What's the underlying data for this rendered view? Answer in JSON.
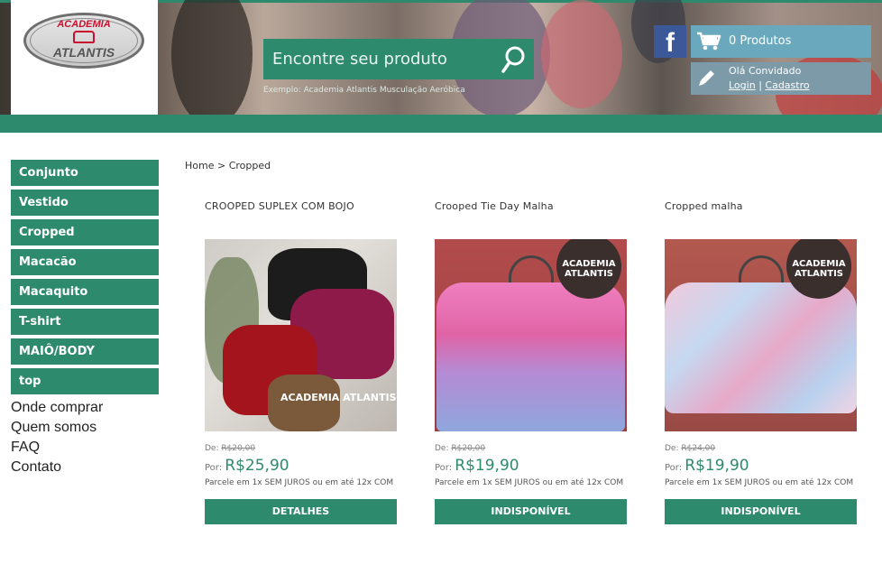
{
  "header": {
    "logo_top": "ACADEMIA",
    "logo_bottom": "ATLANTIS",
    "search": {
      "placeholder": "Encontre seu produto",
      "hint": "Exemplo: Academia Atlantis Musculação Aeróbica"
    },
    "facebook_glyph": "f",
    "cart_label": "0 Produtos",
    "user": {
      "hello": "Olá Convidado",
      "login": "Login",
      "separator": "|",
      "register": "Cadastro"
    }
  },
  "sidebar": {
    "categories": [
      "Conjunto",
      "Vestido",
      "Cropped",
      "Macacão",
      "Macaquito",
      "T-shirt",
      "MAIÔ/BODY",
      "top"
    ],
    "links": [
      "Onde comprar",
      "Quem somos",
      "FAQ",
      "Contato"
    ]
  },
  "breadcrumb": {
    "home": "Home",
    "separator": ">",
    "current": "Cropped"
  },
  "products": [
    {
      "title": "CROOPED SUPLEX COM BOJO",
      "old_label": "De:",
      "old_price": "R$20,00",
      "now_label": "Por:",
      "price": "R$25,90",
      "parcel": "Parcele em 1x SEM JUROS ou em até 12x COM",
      "button": "DETALHES",
      "image_text": "ACADEMIA ATLANTIS"
    },
    {
      "title": "Crooped Tie Day Malha",
      "old_label": "De:",
      "old_price": "R$20,00",
      "now_label": "Por:",
      "price": "R$19,90",
      "parcel": "Parcele em 1x SEM JUROS ou em até 12x COM",
      "button": "INDISPONÍVEL",
      "image_text": "ACADEMIA ATLANTIS"
    },
    {
      "title": "Cropped malha",
      "old_label": "De:",
      "old_price": "R$24,00",
      "now_label": "Por:",
      "price": "R$19,90",
      "parcel": "Parcele em 1x SEM JUROS ou em até 12x COM",
      "button": "INDISPONÍVEL",
      "image_text": "ACADEMIA ATLANTIS"
    }
  ],
  "colors": {
    "brand_green": "#2e8a6c",
    "facebook_blue": "#3b5998",
    "cart_blue": "#6aa9bd",
    "user_gray": "#7c9aa8"
  }
}
